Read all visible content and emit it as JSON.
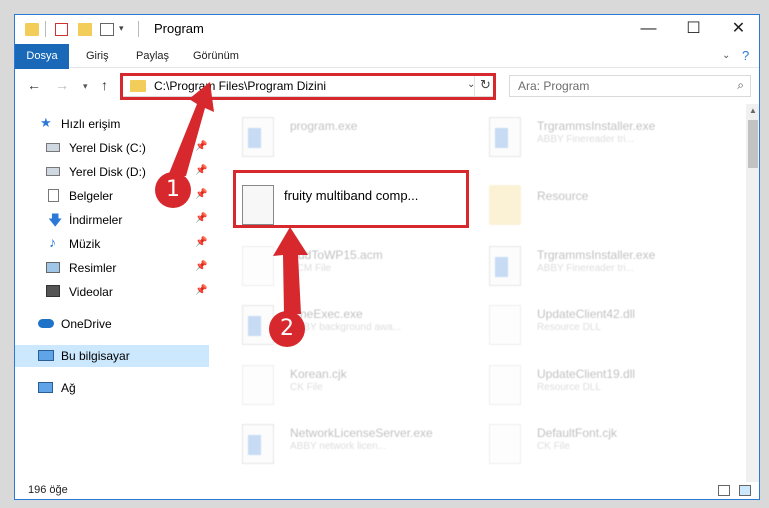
{
  "title": "Program",
  "ribbon": {
    "tabs": [
      "Dosya",
      "Giriş",
      "Paylaş",
      "Görünüm"
    ]
  },
  "address": {
    "path": "C:\\Program Files\\Program Dizini"
  },
  "search": {
    "placeholder": "Ara: Program"
  },
  "sidebar": {
    "items": [
      {
        "label": "Hızlı erişim",
        "icon": "star-icon",
        "pinned": false
      },
      {
        "label": "Yerel Disk (C:)",
        "icon": "drive-icon",
        "pinned": true
      },
      {
        "label": "Yerel Disk (D:)",
        "icon": "drive-icon",
        "pinned": true
      },
      {
        "label": "Belgeler",
        "icon": "documents-icon",
        "pinned": true
      },
      {
        "label": "İndirmeler",
        "icon": "download-icon",
        "pinned": true
      },
      {
        "label": "Müzik",
        "icon": "music-icon",
        "pinned": true
      },
      {
        "label": "Resimler",
        "icon": "pictures-icon",
        "pinned": true
      },
      {
        "label": "Videolar",
        "icon": "videos-icon",
        "pinned": true
      },
      {
        "label": "OneDrive",
        "icon": "cloud-icon",
        "pinned": false
      },
      {
        "label": "Bu bilgisayar",
        "icon": "computer-icon",
        "pinned": false
      },
      {
        "label": "Ağ",
        "icon": "network-icon",
        "pinned": false
      }
    ]
  },
  "files": [
    {
      "name": "program.exe",
      "sub": "",
      "icon": "app",
      "faded": true
    },
    {
      "name": "TrgrammsInstaller.exe",
      "sub": "ABBY Finereader tri...",
      "icon": "win",
      "faded": true
    },
    {
      "name": "fruity multiband comp...",
      "sub": "",
      "icon": "gears",
      "faded": false
    },
    {
      "name": "Resource",
      "sub": "",
      "icon": "folder",
      "faded": true
    },
    {
      "name": "AddToWP15.acm",
      "sub": "ACM File",
      "icon": "doc",
      "faded": true
    },
    {
      "name": "TrgrammsInstaller.exe",
      "sub": "ABBY Finereader tri...",
      "icon": "win",
      "faded": true
    },
    {
      "name": "FineExec.exe",
      "sub": "ABBY background awa...",
      "icon": "win",
      "faded": true
    },
    {
      "name": "UpdateClient42.dll",
      "sub": "Resource DLL",
      "icon": "doc",
      "faded": true
    },
    {
      "name": "Korean.cjk",
      "sub": "CK File",
      "icon": "doc",
      "faded": true
    },
    {
      "name": "UpdateClient19.dll",
      "sub": "Resource DLL",
      "icon": "doc",
      "faded": true
    },
    {
      "name": "NetworkLicenseServer.exe",
      "sub": "ABBY network licen...",
      "icon": "win",
      "faded": true
    },
    {
      "name": "DefaultFont.cjk",
      "sub": "CK File",
      "icon": "doc",
      "faded": true
    }
  ],
  "status": {
    "count": "196 öğe"
  },
  "annotations": {
    "step1": "1",
    "step2": "2"
  },
  "colors": {
    "accent": "#1a69b8",
    "highlight": "#d6282d",
    "selected": "#cce8ff"
  }
}
